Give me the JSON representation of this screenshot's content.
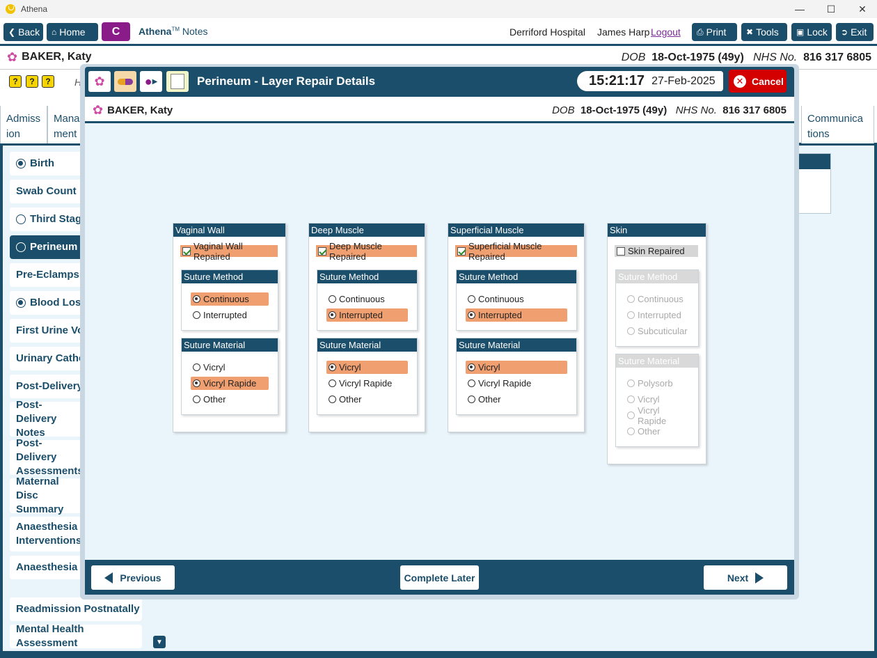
{
  "window": {
    "title": "Athena"
  },
  "toolbar": {
    "back": "Back",
    "home": "Home",
    "c": "C",
    "brand": "Athena",
    "brand_tm": "TM",
    "brand_suffix": " Notes",
    "hospital": "Derriford Hospital",
    "user": "James Harp",
    "logout": "Logout",
    "print": "Print",
    "tools": "Tools",
    "lock": "Lock",
    "exit": "Exit"
  },
  "patient": {
    "name": "BAKER, Katy",
    "dob_label": "DOB",
    "dob": "18-Oct-1975 (49y)",
    "nhs_label": "NHS No.",
    "nhs": "816 317 6805"
  },
  "alerts": [
    "?",
    "?",
    "?"
  ],
  "h_partial": "H",
  "tabs": {
    "admission": "Admiss ion",
    "management": "Mana ment",
    "communications": "Communica tions"
  },
  "sidebar": {
    "items": [
      {
        "label": "Birth",
        "radio": "on"
      },
      {
        "label": "Swab Count",
        "radio": "none"
      },
      {
        "label": "Third Stage",
        "radio": "off"
      },
      {
        "label": "Perineum",
        "radio": "off",
        "active": true
      },
      {
        "label": "Pre-Eclampsia",
        "radio": "none"
      },
      {
        "label": "Blood Loss",
        "radio": "on"
      },
      {
        "label": "First Urine Voi",
        "radio": "none"
      },
      {
        "label": "Urinary Cathe",
        "radio": "none"
      },
      {
        "label": "Post-Delivery",
        "radio": "none"
      },
      {
        "label": "Post-Delivery Notes",
        "radio": "none"
      },
      {
        "label": "Post-Delivery Assessments",
        "radio": "none"
      },
      {
        "label": "Maternal Disc Summary",
        "radio": "none"
      },
      {
        "label": "Anaesthesia Interventions",
        "radio": "none"
      },
      {
        "label": "Anaesthesia F",
        "radio": "none"
      },
      {
        "label": "Readmission Postnatally",
        "radio": "none"
      },
      {
        "label": "Mental Health Assessment",
        "radio": "none"
      }
    ]
  },
  "modal": {
    "title": "Perineum - Layer Repair Details",
    "time": "15:21:17",
    "date": "27-Feb-2025",
    "cancel": "Cancel",
    "groups": [
      {
        "title": "Vaginal Wall",
        "check_label": "Vaginal Wall Repaired",
        "checked": true,
        "method_title": "Suture Method",
        "method_options": [
          "Continuous",
          "Interrupted"
        ],
        "method_selected": "Continuous",
        "material_title": "Suture Material",
        "material_options": [
          "Vicryl",
          "Vicryl Rapide",
          "Other"
        ],
        "material_selected": "Vicryl Rapide"
      },
      {
        "title": "Deep Muscle",
        "check_label": "Deep Muscle Repaired",
        "checked": true,
        "method_title": "Suture Method",
        "method_options": [
          "Continuous",
          "Interrupted"
        ],
        "method_selected": "Interrupted",
        "material_title": "Suture Material",
        "material_options": [
          "Vicryl",
          "Vicryl Rapide",
          "Other"
        ],
        "material_selected": "Vicryl"
      },
      {
        "title": "Superficial Muscle",
        "check_label": "Superficial Muscle Repaired",
        "checked": true,
        "method_title": "Suture Method",
        "method_options": [
          "Continuous",
          "Interrupted"
        ],
        "method_selected": "Interrupted",
        "material_title": "Suture Material",
        "material_options": [
          "Vicryl",
          "Vicryl Rapide",
          "Other"
        ],
        "material_selected": "Vicryl"
      },
      {
        "title": "Skin",
        "check_label": "Skin Repaired",
        "checked": false,
        "method_title": "Suture Method",
        "method_options": [
          "Continuous",
          "Interrupted",
          "Subcuticular"
        ],
        "method_selected": "",
        "material_title": "Suture Material",
        "material_options": [
          "Polysorb",
          "Vicryl",
          "Vicryl Rapide",
          "Other"
        ],
        "material_selected": ""
      }
    ],
    "previous": "Previous",
    "complete_later": "Complete Later",
    "next": "Next"
  },
  "colors": {
    "navy": "#1b4e6b",
    "selected": "#f0a070",
    "cancel": "#d40000",
    "c_button": "#8a1c8a"
  }
}
